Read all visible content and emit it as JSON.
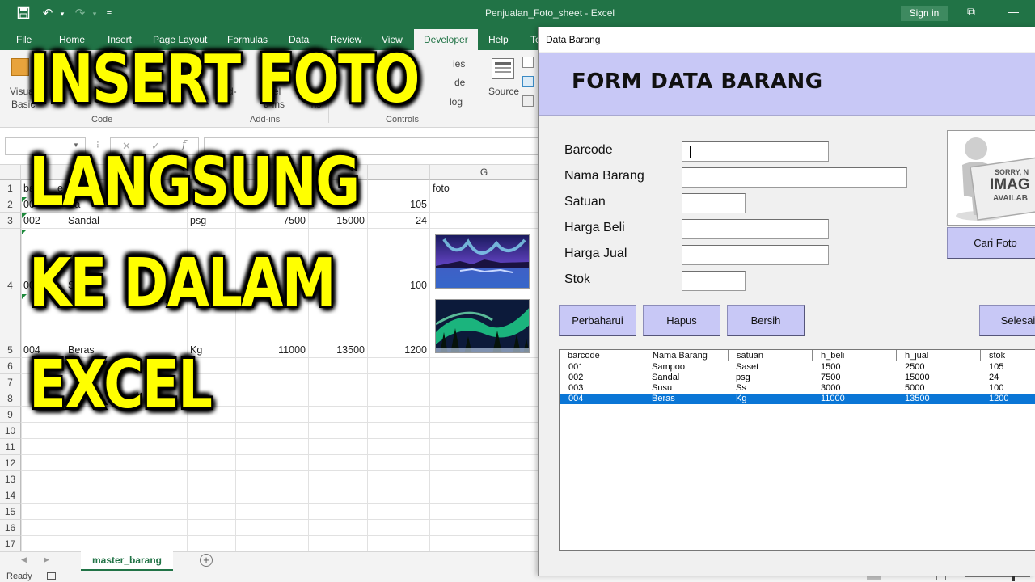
{
  "app": {
    "window_title": "Penjualan_Foto_sheet  -  Excel",
    "sign_in": "Sign in"
  },
  "menu": [
    "File",
    "Home",
    "Insert",
    "Page Layout",
    "Formulas",
    "Data",
    "Review",
    "View",
    "Developer",
    "Help",
    "Te"
  ],
  "ribbon": {
    "visible_fragments": [
      "Visua",
      "Basic",
      "d-",
      "xcel",
      "d-ins",
      "n",
      "ins",
      "ies",
      "de",
      "log"
    ],
    "source_label": "Source",
    "groups": [
      "Code",
      "Add-ins",
      "Controls"
    ]
  },
  "formula_bar": {
    "fx": "f"
  },
  "sheet": {
    "columns": [
      "G"
    ],
    "header_fragments": [
      "ba",
      "e",
      "foto"
    ],
    "row_numbers": [
      "1",
      "2",
      "3",
      "4",
      "5",
      "6",
      "7",
      "8",
      "9",
      "10",
      "11",
      "12",
      "13",
      "14",
      "15",
      "16",
      "17"
    ],
    "visible_cells": {
      "r2c1": "00",
      "r2c2": "Sa",
      "r2c6": "105",
      "r3c1": "002",
      "r3c2": "Sandal",
      "r3c3": "psg",
      "r3c4": "7500",
      "r3c5": "15000",
      "r3c6": "24",
      "r4c1": "00",
      "r4c2": "Su",
      "r4c6": "100",
      "r5c1": "004",
      "r5c2": "Beras",
      "r5c3": "Kg",
      "r5c4": "11000",
      "r5c5": "13500",
      "r5c6": "1200"
    },
    "active_tab": "master_barang"
  },
  "status": {
    "ready": "Ready"
  },
  "overlay_text": [
    "INSERT FOTO",
    "LANGSUNG",
    "KE DALAM",
    "EXCEL"
  ],
  "userform": {
    "title": "Data Barang",
    "heading": "FORM DATA BARANG",
    "labels": {
      "barcode": "Barcode",
      "nama_barang": "Nama Barang",
      "satuan": "Satuan",
      "harga_beli": "Harga Beli",
      "harga_jual": "Harga Jual",
      "stok": "Stok"
    },
    "fields": {
      "barcode": "",
      "nama_barang": "",
      "satuan": "",
      "harga_beli": "",
      "harga_jual": "",
      "stok": ""
    },
    "photo_placeholder": {
      "line1": "SORRY, N",
      "line2": "IMAG",
      "line3": "AVAILAB"
    },
    "buttons": {
      "cari_foto": "Cari Foto",
      "perbaharui": "Perbaharui",
      "hapus": "Hapus",
      "bersih": "Bersih",
      "selesai": "Selesai"
    },
    "listbox": {
      "columns": [
        "barcode",
        "Nama Barang",
        "satuan",
        "h_beli",
        "h_jual",
        "stok"
      ],
      "rows": [
        [
          "001",
          "Sampoo",
          "Saset",
          "1500",
          "2500",
          "105"
        ],
        [
          "002",
          "Sandal",
          "psg",
          "7500",
          "15000",
          "24"
        ],
        [
          "003",
          "Susu",
          "Ss",
          "3000",
          "5000",
          "100"
        ],
        [
          "004",
          "Beras",
          "Kg",
          "11000",
          "13500",
          "1200"
        ]
      ],
      "selected_row": "004"
    }
  }
}
